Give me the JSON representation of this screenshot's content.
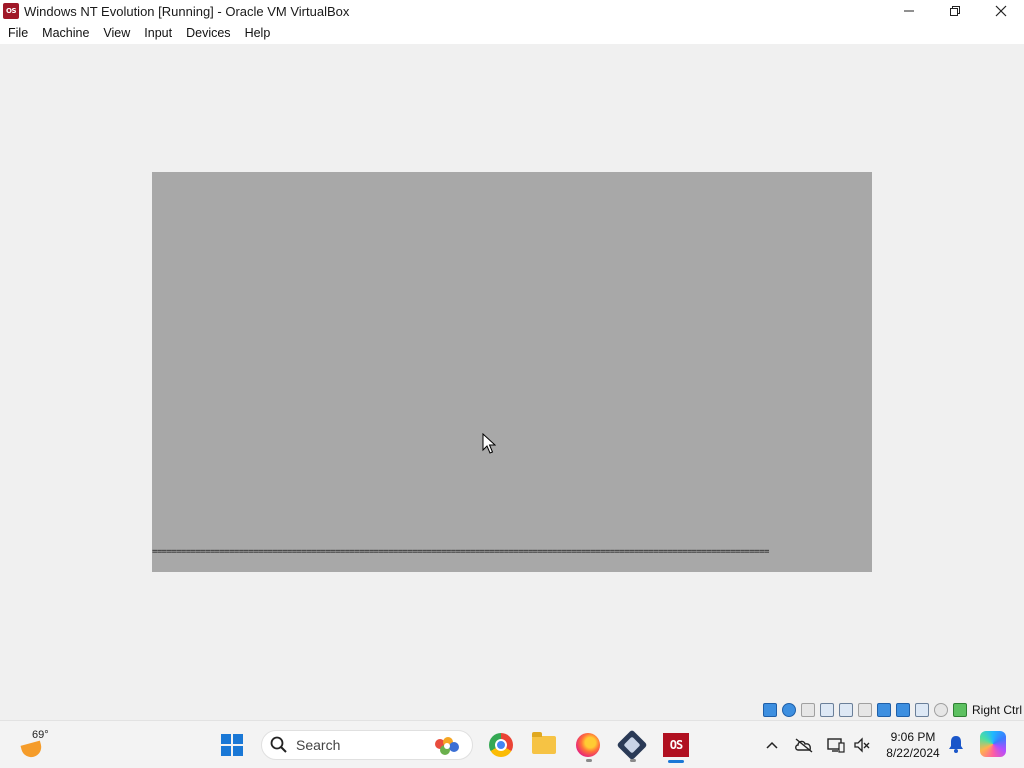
{
  "window": {
    "title": "Windows NT Evolution [Running] - Oracle VM VirtualBox",
    "app_icon_label": "OS",
    "minimize_glyph": "—",
    "restore_glyph": "❐",
    "close_glyph": "✕"
  },
  "menu": {
    "items": [
      "File",
      "Machine",
      "View",
      "Input",
      "Devices",
      "Help"
    ]
  },
  "vm": {
    "background": "#a8a8a8",
    "progress_text": "================================================================================================================================"
  },
  "statusbar": {
    "icons": [
      "hard-disk-icon",
      "optical-drive-icon",
      "floppy-icon",
      "audio-icon",
      "network-icon",
      "usb-icon",
      "shared-folders-icon",
      "display-icon",
      "recording-icon",
      "cpu-icon",
      "mouse-integration-icon",
      "host-key-icon"
    ],
    "host_key": "Right Ctrl"
  },
  "taskbar": {
    "weather_temp": "69°",
    "search_label": "Search",
    "clock_time": "9:06 PM",
    "clock_date": "8/22/2024",
    "tray_chevron": "^",
    "accent": "#1a78d6"
  }
}
